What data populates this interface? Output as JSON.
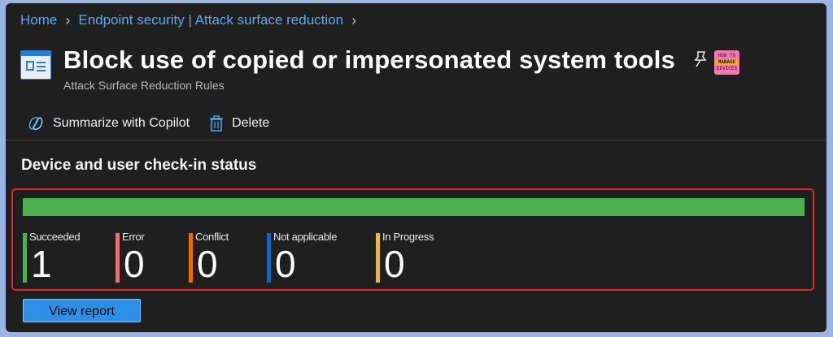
{
  "breadcrumb": {
    "items": [
      "Home",
      "Endpoint security | Attack surface reduction"
    ]
  },
  "header": {
    "title": "Block use of copied or impersonated system tools",
    "subtitle": "Attack Surface Reduction Rules",
    "logo_text": {
      "top": "HOW TO",
      "middle": "MANAGE",
      "bottom": "DEVICES"
    }
  },
  "toolbar": {
    "summarize_label": "Summarize with Copilot",
    "delete_label": "Delete"
  },
  "status": {
    "section_title": "Device and user check-in status",
    "progress_fraction": 1.0,
    "progress_color": "#4caf50",
    "items": [
      {
        "label": "Succeeded",
        "count": "1",
        "color": "#4caf50"
      },
      {
        "label": "Error",
        "count": "0",
        "color": "#e57373"
      },
      {
        "label": "Conflict",
        "count": "0",
        "color": "#ef6c00"
      },
      {
        "label": "Not applicable",
        "count": "0",
        "color": "#1565c0"
      },
      {
        "label": "In Progress",
        "count": "0",
        "color": "#e0b94a"
      }
    ]
  },
  "actions": {
    "view_report_label": "View report"
  },
  "icons": {
    "breadcrumb_separator": "chevron-right-icon",
    "blade": "policy-blade-icon",
    "pin": "pin-icon",
    "copilot": "copilot-icon",
    "delete": "trash-icon"
  }
}
